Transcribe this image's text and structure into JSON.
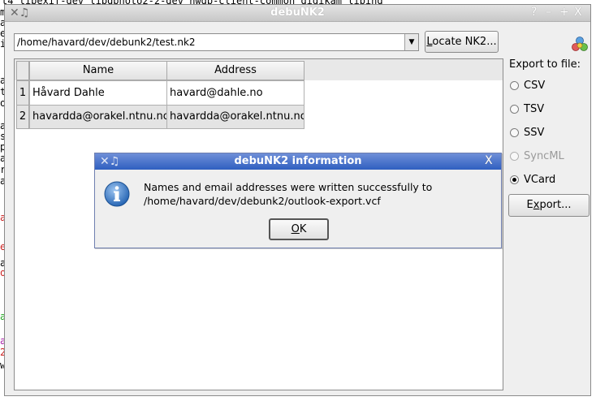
{
  "background": {
    "top_line": "t4 libexif-dev libqphoto2-2-dev hwdb-client-common digikam libind",
    "left_chars": [
      "m",
      "a",
      "e",
      "i",
      "a",
      "t",
      "o",
      "a",
      "s",
      "p",
      "a",
      "r",
      "a",
      "a",
      "e",
      "a",
      "o",
      "a",
      "a",
      "2",
      "w"
    ]
  },
  "window": {
    "title": "debuNK2",
    "close_glyph": "X",
    "help_glyph": "?",
    "min_glyph": "–",
    "pin_glyph": "+"
  },
  "file": {
    "path": "/home/havard/dev/debunk2/test.nk2",
    "locate_label_first": "L",
    "locate_label_rest": "ocate NK2..."
  },
  "table": {
    "columns": [
      "Name",
      "Address"
    ],
    "rows": [
      {
        "num": "1",
        "name": "Håvard Dahle",
        "address": "havard@dahle.no"
      },
      {
        "num": "2",
        "name": "havardda@orakel.ntnu.no",
        "address": "havardda@orakel.ntnu.no"
      }
    ]
  },
  "export": {
    "label": "Export to file:",
    "options": [
      {
        "label": "CSV",
        "checked": false,
        "enabled": true
      },
      {
        "label": "TSV",
        "checked": false,
        "enabled": true
      },
      {
        "label": "SSV",
        "checked": false,
        "enabled": true
      },
      {
        "label": "SyncML",
        "checked": false,
        "enabled": false
      },
      {
        "label": "VCard",
        "checked": true,
        "enabled": true
      }
    ],
    "button_first": "E",
    "button_mid": "x",
    "button_rest": "port..."
  },
  "dialog": {
    "title": "debuNK2 information",
    "close_glyph": "X",
    "message_line1": "Names and email addresses were written successfully to",
    "message_line2": "/home/havard/dev/debunk2/outlook-export.vcf",
    "ok_first": "O",
    "ok_rest": "K"
  },
  "colors": {
    "dialog_title": "#2f5fc0",
    "window_bg": "#efefef"
  },
  "icons": [
    "info-icon",
    "app-icon",
    "dropdown-arrow-icon",
    "window-menu-icon",
    "close-icon",
    "help-icon",
    "minimize-icon",
    "pin-icon"
  ]
}
